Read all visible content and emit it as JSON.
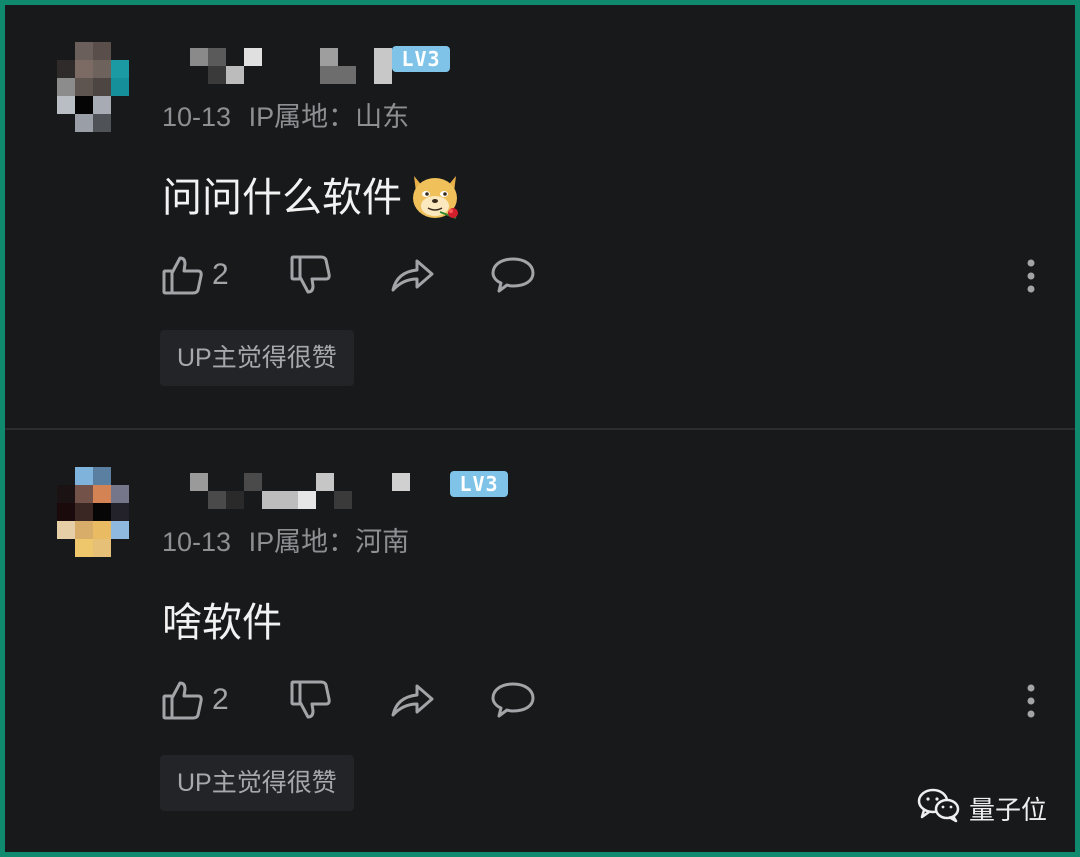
{
  "comments": [
    {
      "user_name": "",
      "level": "LV3",
      "date": "10-13",
      "ip_location": "IP属地：山东",
      "text": "问问什么软件",
      "emoji": "doge-rose-emoji",
      "likes": "2",
      "up_tag": "UP主觉得很赞"
    },
    {
      "user_name": "",
      "level": "LV3",
      "date": "10-13",
      "ip_location": "IP属地：河南",
      "text": "啥软件",
      "likes": "2",
      "up_tag": "UP主觉得很赞"
    }
  ],
  "icons": {
    "like": "thumbs-up-icon",
    "dislike": "thumbs-down-icon",
    "share": "share-arrow-icon",
    "reply": "speech-bubble-icon",
    "more": "vertical-ellipsis-icon",
    "watermark": "wechat-icon"
  },
  "colors": {
    "background": "#18191b",
    "border": "#0f8a6e",
    "level_badge": "#7fc3e9",
    "meta_text": "#8e8f93"
  },
  "watermark": {
    "label": "量子位"
  }
}
